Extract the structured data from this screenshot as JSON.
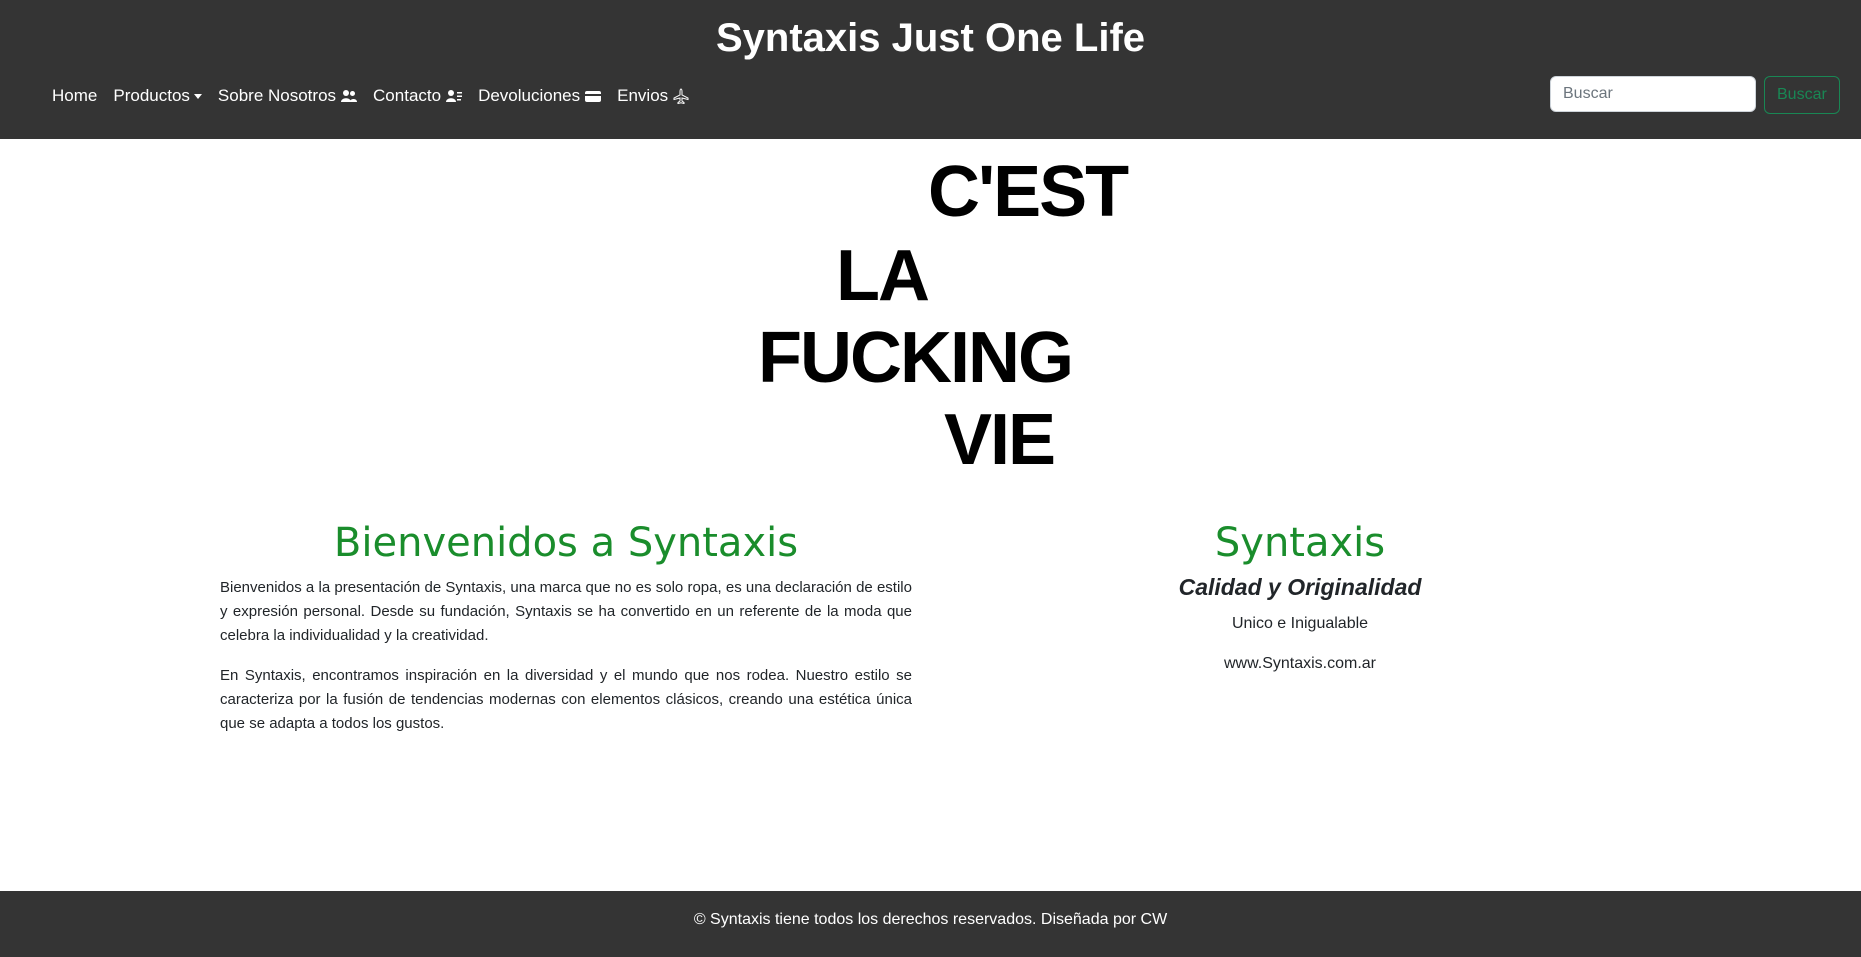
{
  "header": {
    "title": "Syntaxis Just One Life",
    "nav": [
      {
        "label": "Home",
        "icon": null
      },
      {
        "label": "Productos",
        "icon": "caret-down-icon"
      },
      {
        "label": "Sobre Nosotros",
        "icon": "people-icon"
      },
      {
        "label": "Contacto",
        "icon": "person-lines-icon"
      },
      {
        "label": "Devoluciones",
        "icon": "card-icon"
      },
      {
        "label": "Envios",
        "icon": "airplane-icon"
      }
    ],
    "search": {
      "placeholder": "Buscar",
      "button_label": "Buscar"
    }
  },
  "hero": {
    "lines": [
      "C'EST",
      "LA",
      "FUCKING",
      "VIE"
    ]
  },
  "welcome": {
    "title": "Bienvenidos a Syntaxis",
    "paragraphs": [
      "Bienvenidos a la presentación de Syntaxis, una marca que no es solo ropa, es una declaración de estilo y expresión personal. Desde su fundación, Syntaxis se ha convertido en un referente de la moda que celebra la individualidad y la creatividad.",
      "En Syntaxis, encontramos inspiración en la diversidad y el mundo que nos rodea. Nuestro estilo se caracteriza por la fusión de tendencias modernas con elementos clásicos, creando una estética única que se adapta a todos los gustos."
    ]
  },
  "brand": {
    "title": "Syntaxis",
    "subtitle": "Calidad y Originalidad",
    "tagline": "Unico e Inigualable",
    "website": "www.Syntaxis.com.ar"
  },
  "footer": {
    "text": "© Syntaxis tiene todos los derechos reservados. Diseñada por CW"
  },
  "colors": {
    "header_bg": "#343434",
    "accent_green": "#1a8d2c",
    "button_green": "#198754"
  }
}
